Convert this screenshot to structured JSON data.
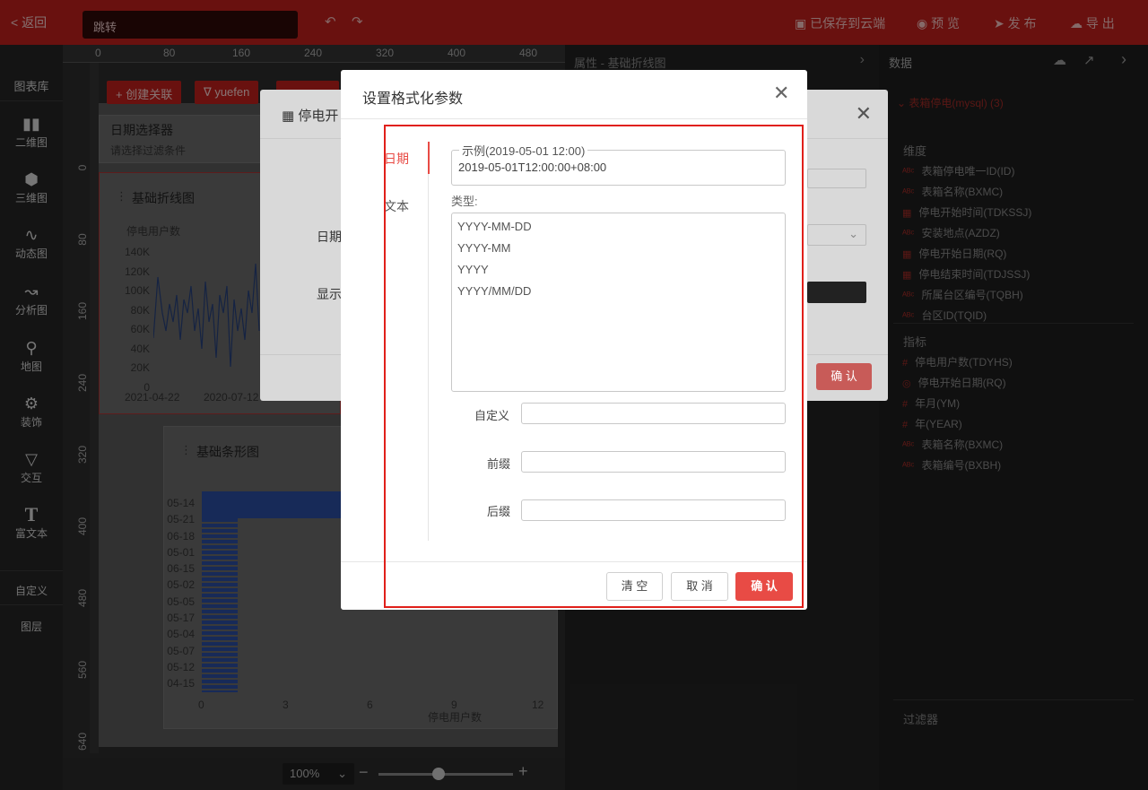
{
  "topbar": {
    "back": "< 返回",
    "title_input": "跳转",
    "undo_icon": "undo-icon",
    "redo_icon": "redo-icon",
    "save_cloud": "已保存到云端",
    "preview": "预 览",
    "publish": "发 布",
    "export": "导 出"
  },
  "leftbar": {
    "library": "图表库",
    "items": [
      "二维图",
      "三维图",
      "动态图",
      "分析图",
      "地图",
      "装饰",
      "交互",
      "富文本"
    ],
    "custom": "自定义",
    "layers": "图层"
  },
  "canvas": {
    "ruler_top": [
      "0",
      "80",
      "160",
      "240",
      "320",
      "400",
      "480"
    ],
    "ruler_left": [
      "0",
      "80",
      "160",
      "240",
      "320",
      "400",
      "480",
      "560",
      "640"
    ],
    "create_link": "+ 创建关联",
    "user_tag": "yuefen",
    "date_picker_title": "日期选择器",
    "date_picker_hint": "请选择过滤条件",
    "line_chart_title": "基础折线图",
    "line_chart_ylabel": "停电用户数",
    "line_chart_yticks": [
      "140K",
      "120K",
      "100K",
      "80K",
      "60K",
      "40K",
      "20K",
      "0"
    ],
    "line_chart_xticks": [
      "2021-04-22",
      "2020-07-12"
    ],
    "bar_chart_title": "基础条形图",
    "bar_chart_categories": [
      "05-14",
      "05-21",
      "06-18",
      "05-01",
      "06-15",
      "05-02",
      "05-05",
      "05-17",
      "05-04",
      "05-07",
      "05-12",
      "04-15"
    ],
    "bar_chart_xticks": [
      "0",
      "3",
      "6",
      "9",
      "12"
    ],
    "bar_chart_xlabel": "停电用户数"
  },
  "props": {
    "header": "属性  -  基础折线图"
  },
  "datapanel": {
    "header": "数据",
    "source": "表箱停电(mysql) (3)",
    "dimension_title": "维度",
    "dimensions": [
      "表箱停电唯一ID(ID)",
      "表箱名称(BXMC)",
      "停电开始时间(TDKSSJ)",
      "安装地点(AZDZ)",
      "停电开始日期(RQ)",
      "停电结束时间(TDJSSJ)",
      "所属台区编号(TQBH)",
      "台区ID(TQID)"
    ],
    "metric_title": "指标",
    "metrics": [
      "停电用户数(TDYHS)",
      "停电开始日期(RQ)",
      "年月(YM)",
      "年(YEAR)",
      "表箱名称(BXMC)",
      "表箱编号(BXBH)"
    ],
    "filter_title": "过滤器"
  },
  "back_dialog": {
    "title": "停电开",
    "label_date": "日期",
    "label_show": "显示",
    "confirm": "确 认"
  },
  "dialog": {
    "title": "设置格式化参数",
    "tabs": [
      "日期",
      "文本"
    ],
    "example_legend": "示例(2019-05-01 12:00)",
    "example_value": "2019-05-01T12:00:00+08:00",
    "type_label": "类型:",
    "type_options": [
      "YYYY-MM-DD",
      "YYYY-MM",
      "YYYY",
      "YYYY/MM/DD"
    ],
    "custom_label": "自定义",
    "prefix_label": "前缀",
    "suffix_label": "后缀",
    "clear": "清 空",
    "cancel": "取 消",
    "confirm": "确 认"
  },
  "zoom": {
    "level": "100%"
  },
  "colors": {
    "brand_red": "#c0201c",
    "accent_red": "#e84b45"
  }
}
